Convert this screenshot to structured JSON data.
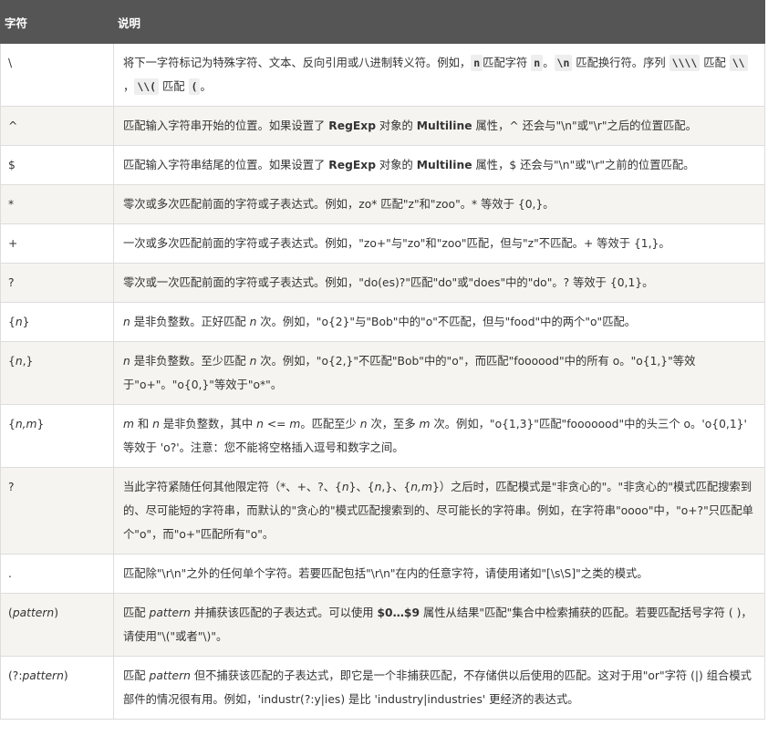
{
  "header": {
    "col_char": "字符",
    "col_desc": "说明"
  },
  "rows": [
    {
      "symbol": [
        {
          "t": "\\"
        }
      ],
      "desc": [
        {
          "t": "将下一字符标记为特殊字符、文本、反向引用或八进制转义符。例如，"
        },
        {
          "t": "n",
          "s": "code"
        },
        {
          "t": "匹配字符 "
        },
        {
          "t": "n",
          "s": "code"
        },
        {
          "t": "。"
        },
        {
          "t": "\\n",
          "s": "code"
        },
        {
          "t": " 匹配换行符。序列 "
        },
        {
          "t": "\\\\\\\\",
          "s": "code"
        },
        {
          "t": " 匹配 "
        },
        {
          "t": "\\\\",
          "s": "code"
        },
        {
          "t": " ，"
        },
        {
          "t": "\\\\(",
          "s": "code"
        },
        {
          "t": " 匹配 "
        },
        {
          "t": "(",
          "s": "code"
        },
        {
          "t": "。"
        }
      ]
    },
    {
      "symbol": [
        {
          "t": "^"
        }
      ],
      "desc": [
        {
          "t": "匹配输入字符串开始的位置。如果设置了 "
        },
        {
          "t": "RegExp",
          "s": "b"
        },
        {
          "t": " 对象的 "
        },
        {
          "t": "Multiline",
          "s": "b"
        },
        {
          "t": " 属性，^ 还会与\"\\n\"或\"\\r\"之后的位置匹配。"
        }
      ]
    },
    {
      "symbol": [
        {
          "t": "$"
        }
      ],
      "desc": [
        {
          "t": "匹配输入字符串结尾的位置。如果设置了 "
        },
        {
          "t": "RegExp",
          "s": "b"
        },
        {
          "t": " 对象的 "
        },
        {
          "t": "Multiline",
          "s": "b"
        },
        {
          "t": " 属性，$ 还会与\"\\n\"或\"\\r\"之前的位置匹配。"
        }
      ]
    },
    {
      "symbol": [
        {
          "t": "*"
        }
      ],
      "desc": [
        {
          "t": "零次或多次匹配前面的字符或子表达式。例如，zo* 匹配\"z\"和\"zoo\"。* 等效于 {0,}。"
        }
      ]
    },
    {
      "symbol": [
        {
          "t": "+"
        }
      ],
      "desc": [
        {
          "t": "一次或多次匹配前面的字符或子表达式。例如，\"zo+\"与\"zo\"和\"zoo\"匹配，但与\"z\"不匹配。+ 等效于 {1,}。"
        }
      ]
    },
    {
      "symbol": [
        {
          "t": "?"
        }
      ],
      "desc": [
        {
          "t": "零次或一次匹配前面的字符或子表达式。例如，\"do(es)?\"匹配\"do\"或\"does\"中的\"do\"。? 等效于 {0,1}。"
        }
      ]
    },
    {
      "symbol": [
        {
          "t": "{"
        },
        {
          "t": "n",
          "s": "i"
        },
        {
          "t": "}"
        }
      ],
      "desc": [
        {
          "t": "n",
          "s": "i"
        },
        {
          "t": " 是非负整数。正好匹配 "
        },
        {
          "t": "n",
          "s": "i"
        },
        {
          "t": " 次。例如，\"o{2}\"与\"Bob\"中的\"o\"不匹配，但与\"food\"中的两个\"o\"匹配。"
        }
      ]
    },
    {
      "symbol": [
        {
          "t": "{"
        },
        {
          "t": "n",
          "s": "i"
        },
        {
          "t": ",}"
        }
      ],
      "desc": [
        {
          "t": "n",
          "s": "i"
        },
        {
          "t": " 是非负整数。至少匹配 "
        },
        {
          "t": "n",
          "s": "i"
        },
        {
          "t": " 次。例如，\"o{2,}\"不匹配\"Bob\"中的\"o\"，而匹配\"foooood\"中的所有 o。\"o{1,}\"等效于\"o+\"。\"o{0,}\"等效于\"o*\"。"
        }
      ]
    },
    {
      "symbol": [
        {
          "t": "{"
        },
        {
          "t": "n,m",
          "s": "i"
        },
        {
          "t": "}"
        }
      ],
      "desc": [
        {
          "t": "m",
          "s": "i"
        },
        {
          "t": " 和 "
        },
        {
          "t": "n",
          "s": "i"
        },
        {
          "t": " 是非负整数，其中 "
        },
        {
          "t": "n",
          "s": "i"
        },
        {
          "t": " <= "
        },
        {
          "t": "m",
          "s": "i"
        },
        {
          "t": "。匹配至少 "
        },
        {
          "t": "n",
          "s": "i"
        },
        {
          "t": " 次，至多 "
        },
        {
          "t": "m",
          "s": "i"
        },
        {
          "t": " 次。例如，\"o{1,3}\"匹配\"fooooood\"中的头三个 o。'o{0,1}' 等效于 'o?'。注意：您不能将空格插入逗号和数字之间。"
        }
      ]
    },
    {
      "symbol": [
        {
          "t": "?"
        }
      ],
      "desc": [
        {
          "t": "当此字符紧随任何其他限定符（*、+、?、{"
        },
        {
          "t": "n",
          "s": "i"
        },
        {
          "t": "}、{"
        },
        {
          "t": "n",
          "s": "i"
        },
        {
          "t": ",}、{"
        },
        {
          "t": "n,m",
          "s": "i"
        },
        {
          "t": "}）之后时，匹配模式是\"非贪心的\"。\"非贪心的\"模式匹配搜索到的、尽可能短的字符串，而默认的\"贪心的\"模式匹配搜索到的、尽可能长的字符串。例如，在字符串\"oooo\"中，\"o+?\"只匹配单个\"o\"，而\"o+\"匹配所有\"o\"。"
        }
      ]
    },
    {
      "symbol": [
        {
          "t": "."
        }
      ],
      "desc": [
        {
          "t": "匹配除\"\\r\\n\"之外的任何单个字符。若要匹配包括\"\\r\\n\"在内的任意字符，请使用诸如\"[\\s\\S]\"之类的模式。"
        }
      ]
    },
    {
      "symbol": [
        {
          "t": "("
        },
        {
          "t": "pattern",
          "s": "i"
        },
        {
          "t": ")"
        }
      ],
      "desc": [
        {
          "t": "匹配 "
        },
        {
          "t": "pattern",
          "s": "i"
        },
        {
          "t": " 并捕获该匹配的子表达式。可以使用 "
        },
        {
          "t": "$0…$9",
          "s": "b"
        },
        {
          "t": " 属性从结果\"匹配\"集合中检索捕获的匹配。若要匹配括号字符 ( )，请使用\"\\(\"或者\"\\)\"。"
        }
      ]
    },
    {
      "symbol": [
        {
          "t": "(?:"
        },
        {
          "t": "pattern",
          "s": "i"
        },
        {
          "t": ")"
        }
      ],
      "desc": [
        {
          "t": "匹配 "
        },
        {
          "t": "pattern",
          "s": "i"
        },
        {
          "t": " 但不捕获该匹配的子表达式，即它是一个非捕获匹配，不存储供以后使用的匹配。这对于用\"or\"字符 (|) 组合模式部件的情况很有用。例如，'industr(?:y|ies) 是比 'industry|industries' 更经济的表达式。"
        }
      ]
    }
  ]
}
